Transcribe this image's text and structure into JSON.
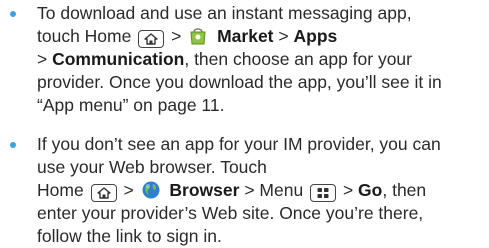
{
  "colors": {
    "bullet": "#3aa3dc"
  },
  "icons": {
    "home_key": "home-icon",
    "market": "market-bag-icon",
    "browser": "globe-icon",
    "menu_key": "menu-grid-icon"
  },
  "bullet1": {
    "l1": "To download and use an instant messaging app,",
    "l2_a": "touch Home",
    "sep1": ">",
    "market": "Market",
    "sep2": ">",
    "apps": "Apps",
    "l3_sep": ">",
    "communication": "Communication",
    "l3_b": ", then choose an app for your",
    "l4": "provider. Once you download the app, you’ll see it in",
    "l5": "“App menu” on page 11."
  },
  "bullet2": {
    "l1": "If you don’t see an app for your IM provider, you can",
    "l2": "use your Web browser. Touch",
    "l3_a": "Home",
    "sep1": ">",
    "browser": "Browser",
    "sep2": "> Menu",
    "sep3": ">",
    "go": "Go",
    "l3_b": ", then",
    "l4": "enter your provider’s Web site. Once you’re there,",
    "l5": "follow the link to sign in."
  }
}
